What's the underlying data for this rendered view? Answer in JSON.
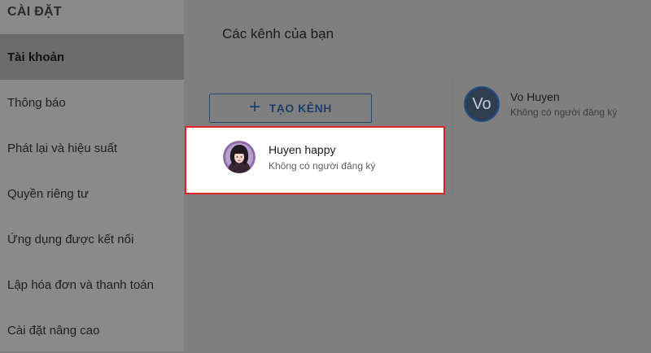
{
  "sidebar": {
    "title": "CÀI ĐẶT",
    "items": [
      {
        "label": "Tài khoản",
        "active": true
      },
      {
        "label": "Thông báo"
      },
      {
        "label": "Phát lại và hiệu suất"
      },
      {
        "label": "Quyền riêng tư"
      },
      {
        "label": "Ứng dụng được kết nối"
      },
      {
        "label": "Lập hóa đơn và thanh toán"
      },
      {
        "label": "Cài đặt nâng cao"
      }
    ]
  },
  "main": {
    "title": "Các kênh của bạn",
    "create_button": {
      "icon": "plus-icon",
      "label": "TẠO KÊNH"
    },
    "channels": [
      {
        "name": "Huyen happy",
        "subscribers": "Không có người đăng ký",
        "highlighted": true
      }
    ],
    "current_account": {
      "initials": "Vo",
      "name": "Vo Huyen",
      "subscribers": "Không có người đăng ký"
    }
  },
  "colors": {
    "highlight_border": "#e0212a",
    "button_text": "#1c3e6a"
  }
}
